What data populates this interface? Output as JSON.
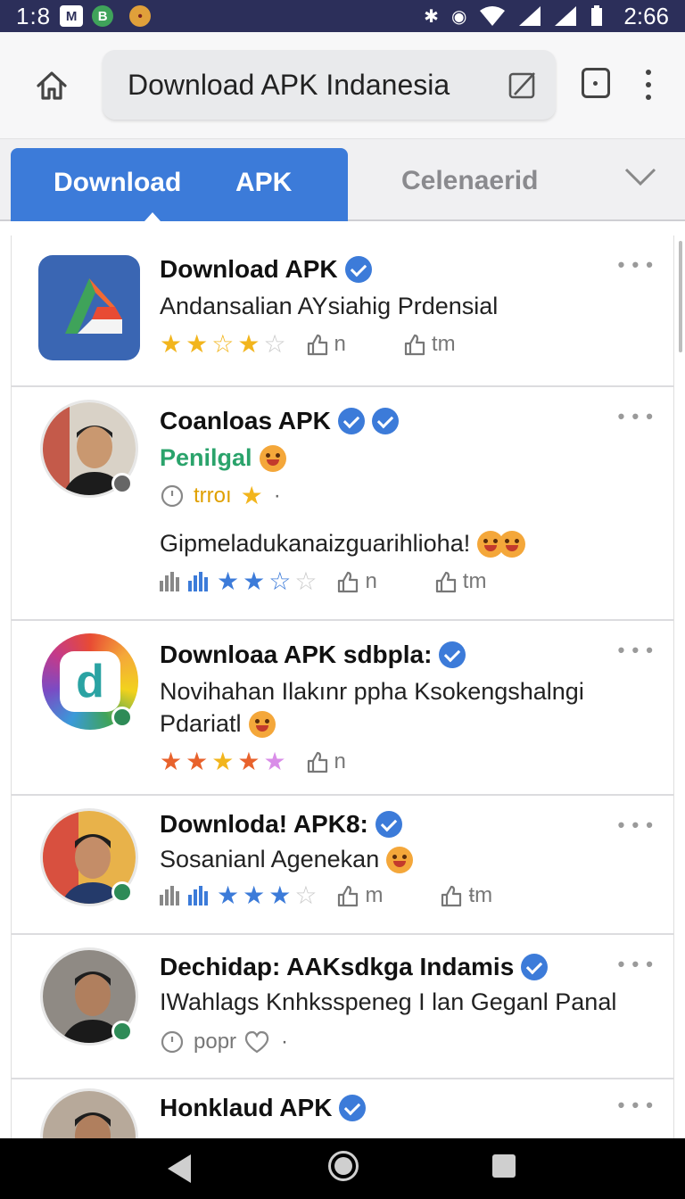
{
  "status_bar": {
    "time_left": "1:8",
    "time_right": "2:66"
  },
  "address_bar": {
    "url_text": "Download APK Indanesia"
  },
  "tabs": {
    "active_label_1": "Download",
    "active_label_2": "APK",
    "inactive_label": "Celenaerid"
  },
  "items": [
    {
      "title": "Download APK",
      "subtitle": "Andansalian AYsiahig Prdensial",
      "thumb1": "n",
      "thumb2": "tm"
    },
    {
      "title": "Coanloas APK",
      "subtitle": "Penilgal",
      "line3": "trroı",
      "line4": "Gipmeladukanaizguarihlioha!",
      "thumb1": "n",
      "thumb2": "tm"
    },
    {
      "title": "Downloaa APK sdbpla:",
      "subtitle": "Novihahan Ilakınr ppha Ksokеngshalngi",
      "subtitle2": "Pdariatl",
      "thumb1": "n"
    },
    {
      "title": "Downloda! APK8:",
      "subtitle": "Sosanianl Agenekan",
      "thumb1": "m",
      "thumb2": "ŧm"
    },
    {
      "title": "Dechidap: AAKsdkga Indamis",
      "subtitle": "IWahlags Knhksspeneg I lan Geganl Panal",
      "line3": "popr"
    },
    {
      "title": "Honklaud APK"
    }
  ],
  "colors": {
    "accent": "#3c7bd9",
    "status_bar": "#2c2f5a",
    "green": "#2aa36b",
    "star": "#f2b51d"
  },
  "icons": [
    "home-icon",
    "edit-icon",
    "tabs-icon",
    "more-vert-icon",
    "chevron-down-icon",
    "verified-icon",
    "star-icon",
    "thumb-icon",
    "bar-chart-icon",
    "clock-icon",
    "heart-icon",
    "back-icon",
    "recent-icon"
  ]
}
